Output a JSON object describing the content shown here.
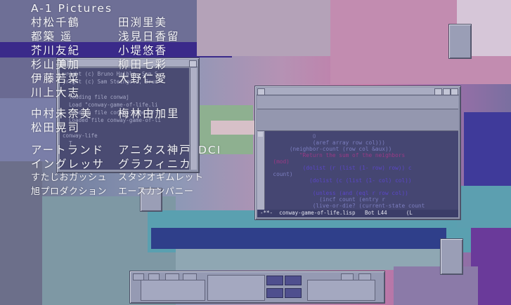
{
  "credits": {
    "studio": "A-1 Pictures",
    "rows": [
      {
        "left": "村松千鶴",
        "right": "田渕里美"
      },
      {
        "left": "都築 遥",
        "right": "浅見日香留"
      },
      {
        "left": "芥川友紀",
        "right": "小堤悠香"
      },
      {
        "left": "杉山美加",
        "right": "柳田七彩"
      },
      {
        "left": "伊藤若菜",
        "right": "大野仁愛"
      },
      {
        "left": "川上大志",
        "right": ""
      },
      {
        "left": "中村未奈美",
        "right": "梅林由加里"
      },
      {
        "left": "松田晃司",
        "right": ""
      },
      {
        "left": "アートランド",
        "right": "アニタス神戸",
        "extra": "DCI"
      },
      {
        "left": "イングレッサ",
        "right": "グラフィニカ"
      },
      {
        "left": "すたじおガッシュ",
        "right": "スタジオギムレット"
      },
      {
        "left": "旭プロダクション",
        "right": "エースカンパニー"
      }
    ]
  },
  "terminal": {
    "lines": [
      "yright (c) Bruno Haible, Sam S",
      "yright (c) Sam Steingold, Brun",
      "",
      "  loading file conwaj",
      "  Load \"conway-game-of-life.li",
      "  Loading file conway-game-of-li",
      "  Loaded file conway-game-of-li",
      "",
      "conway-life",
      "  T"
    ]
  },
  "editor": {
    "code_lines": [
      {
        "text": "              0",
        "color": "#6d6fa6"
      },
      {
        "text": "              (aref array row col)))",
        "color": "#7c7ec0"
      },
      {
        "text": "       (neighbor-count (row col &aux))",
        "color": "#7c7ec0"
      },
      {
        "text": "          \"Return the sum of the neighbors",
        "color": "#9b3a86"
      },
      {
        "text": "  (mod)",
        "color": "#9b3a86"
      },
      {
        "text": "           (dolist (r (list (1- row) row)) c",
        "color": "#5b46c8"
      },
      {
        "text": "  count)",
        "color": "#7c7ec0"
      },
      {
        "text": "             (dolist (c (list (1- col) col))",
        "color": "#5b46c8"
      },
      {
        "text": "",
        "color": "#7c7ec0"
      },
      {
        "text": "              (unless (and (eql r row col))",
        "color": "#5b46c8"
      },
      {
        "text": "                (incf count (entry r",
        "color": "#7c7ec0"
      },
      {
        "text": "              (live-or-die? (current-state count",
        "color": "#7c7ec0"
      }
    ],
    "modeline": "-**-  conway-game-of-life.lisp   Bot L44      (L"
  },
  "taskbar": {
    "pager_cells": 4
  },
  "colors": {
    "pager_active": "#4f4f8e",
    "window_frame": "#8f93ab"
  }
}
